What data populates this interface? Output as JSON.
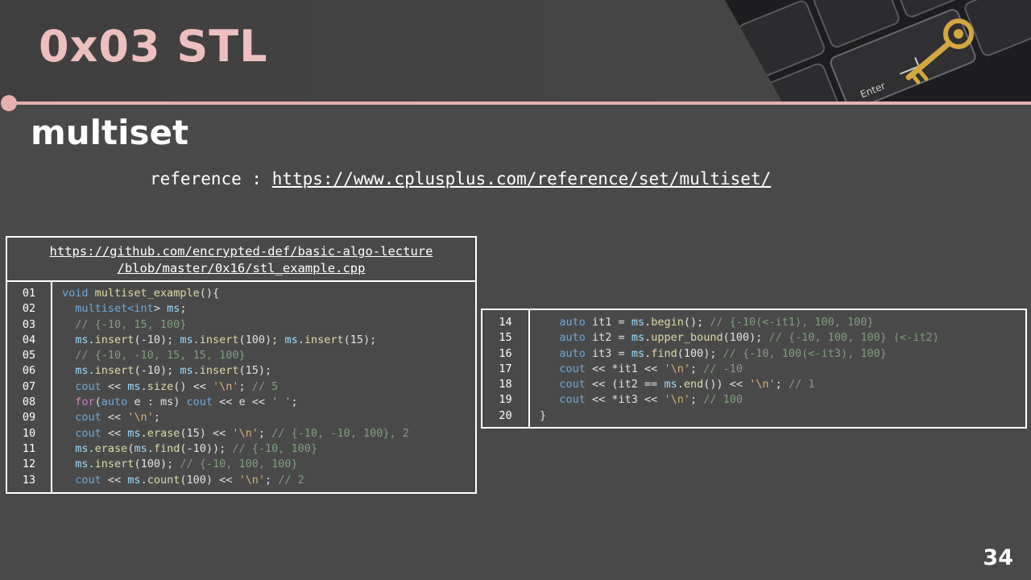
{
  "slide": {
    "title": "0x03  STL",
    "subtitle": "multiset",
    "reference_label": "reference : ",
    "reference_url": "https://www.cplusplus.com/reference/set/multiset/",
    "page_number": "34"
  },
  "code_box_1": {
    "link_line1": "https://github.com/encrypted-def/basic-algo-lecture",
    "link_line2": "/blob/master/0x16/stl_example.cpp",
    "line_numbers": [
      "01",
      "02",
      "03",
      "04",
      "05",
      "06",
      "07",
      "08",
      "09",
      "10",
      "11",
      "12",
      "13"
    ]
  },
  "code_box_2": {
    "line_numbers": [
      "14",
      "15",
      "16",
      "17",
      "18",
      "19",
      "20"
    ]
  },
  "code": {
    "l01_a": "void",
    "l01_b": "multiset_example",
    "l01_c": "(){",
    "l02_a": "multiset<",
    "l02_b": "int",
    "l02_c": "> ",
    "l02_d": "ms",
    "l02_e": ";",
    "l03": "// {-10, 15, 100}",
    "l04_a": "ms",
    "l04_b": "insert",
    "l04_c": "(-10); ",
    "l04_d": "ms",
    "l04_e": "insert",
    "l04_f": "(100); ",
    "l04_g": "ms",
    "l04_h": "insert",
    "l04_i": "(15);",
    "l05": "// {-10, -10, 15, 15, 100}",
    "l06_a": "ms",
    "l06_b": "insert",
    "l06_c": "(-10); ",
    "l06_d": "ms",
    "l06_e": "insert",
    "l06_f": "(15);",
    "l07_a": "cout",
    "l07_b": " << ",
    "l07_c": "ms",
    "l07_d": "size",
    "l07_e": "() << ",
    "l07_f": "'\\n'",
    "l07_g": "; ",
    "l07_h": "// 5",
    "l08_a": "for",
    "l08_b": "(",
    "l08_c": "auto",
    "l08_d": " e : ms) ",
    "l08_e": "cout",
    "l08_f": " << e << ",
    "l08_g": "' '",
    "l08_h": ";",
    "l09_a": "cout",
    "l09_b": " << ",
    "l09_c": "'\\n'",
    "l09_d": ";",
    "l10_a": "cout",
    "l10_b": " << ",
    "l10_c": "ms",
    "l10_d": "erase",
    "l10_e": "(15) << ",
    "l10_f": "'\\n'",
    "l10_g": "; ",
    "l10_h": "// {-10, -10, 100}, 2",
    "l11_a": "ms",
    "l11_b": "erase",
    "l11_c": "(",
    "l11_d": "ms",
    "l11_e": "find",
    "l11_f": "(-10)); ",
    "l11_g": "// {-10, 100}",
    "l12_a": "ms",
    "l12_b": "insert",
    "l12_c": "(100); ",
    "l12_d": "// {-10, 100, 100}",
    "l13_a": "cout",
    "l13_b": " << ",
    "l13_c": "ms",
    "l13_d": "count",
    "l13_e": "(100) << ",
    "l13_f": "'\\n'",
    "l13_g": "; ",
    "l13_h": "// 2",
    "l14_a": "auto",
    "l14_b": " it1 = ",
    "l14_c": "ms",
    "l14_d": "begin",
    "l14_e": "(); ",
    "l14_f": "// {-10(<-it1), 100, 100}",
    "l15_a": "auto",
    "l15_b": " it2 = ",
    "l15_c": "ms",
    "l15_d": "upper_bound",
    "l15_e": "(100); ",
    "l15_f": "// {-10, 100, 100} (<-it2)",
    "l16_a": "auto",
    "l16_b": " it3 = ",
    "l16_c": "ms",
    "l16_d": "find",
    "l16_e": "(100); ",
    "l16_f": "// {-10, 100(<-it3), 100}",
    "l17_a": "cout",
    "l17_b": " << *it1 << ",
    "l17_c": "'\\n'",
    "l17_d": "; ",
    "l17_e": "// -10",
    "l18_a": "cout",
    "l18_b": " << (it2 == ",
    "l18_c": "ms",
    "l18_d": "end",
    "l18_e": "()) << ",
    "l18_f": "'\\n'",
    "l18_g": "; ",
    "l18_h": "// 1",
    "l19_a": "cout",
    "l19_b": " << *it3 << ",
    "l19_c": "'\\n'",
    "l19_d": "; ",
    "l19_e": "// 100",
    "l20": "}"
  },
  "colors": {
    "background": "#4a4949",
    "accent_pink": "#e6b0b0",
    "title_pink": "#eebfbf",
    "keyword_blue": "#6fa8dc",
    "comment_green": "#7f9f7f",
    "string_tan": "#d6b07a"
  },
  "decor": {
    "header_image": "keyboard-with-golden-key-image"
  }
}
